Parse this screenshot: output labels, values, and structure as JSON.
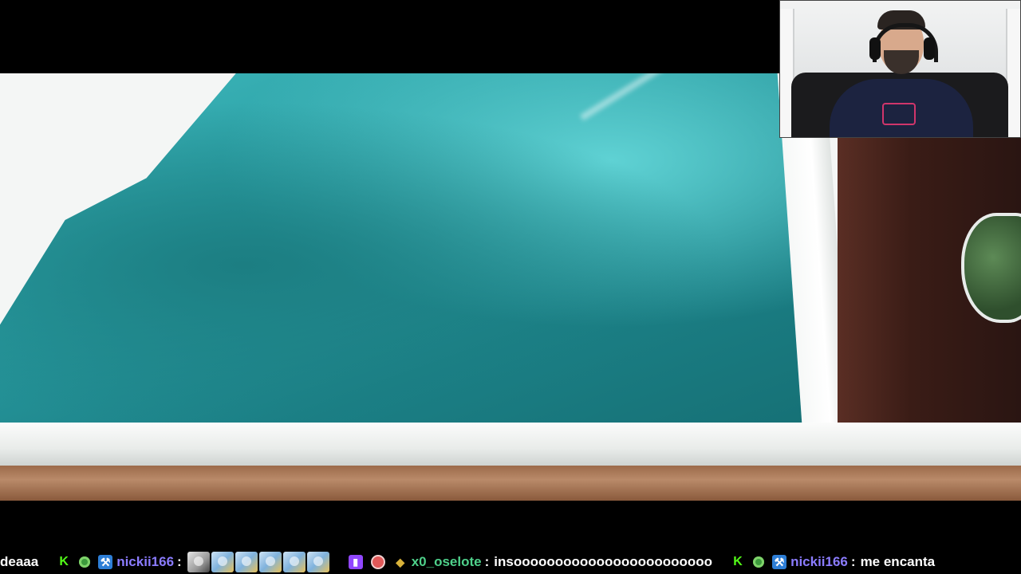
{
  "ticker": {
    "prev_msg_tail": "deaaa",
    "msg1": {
      "badges": [
        "kick-icon",
        "green-badge-icon",
        "pickaxe-badge-icon"
      ],
      "user": "nickii166",
      "sep": ":",
      "emote_count": 6
    },
    "msg2": {
      "badges": [
        "twitch-icon",
        "red-badge-icon",
        "gold-shield-icon"
      ],
      "user": "x0_oselote",
      "sep": ":",
      "text": "insoooooooooooooooooooooooo"
    },
    "msg3": {
      "badges": [
        "kick-icon",
        "green-badge-icon",
        "pickaxe-badge-icon"
      ],
      "user": "nickii166",
      "sep": ":",
      "text": "me encanta"
    }
  },
  "colors": {
    "username_kick": "#8b7cff",
    "username_twitch": "#4fd18b",
    "kick_green": "#53fc18",
    "twitch_purple": "#9147ff"
  }
}
